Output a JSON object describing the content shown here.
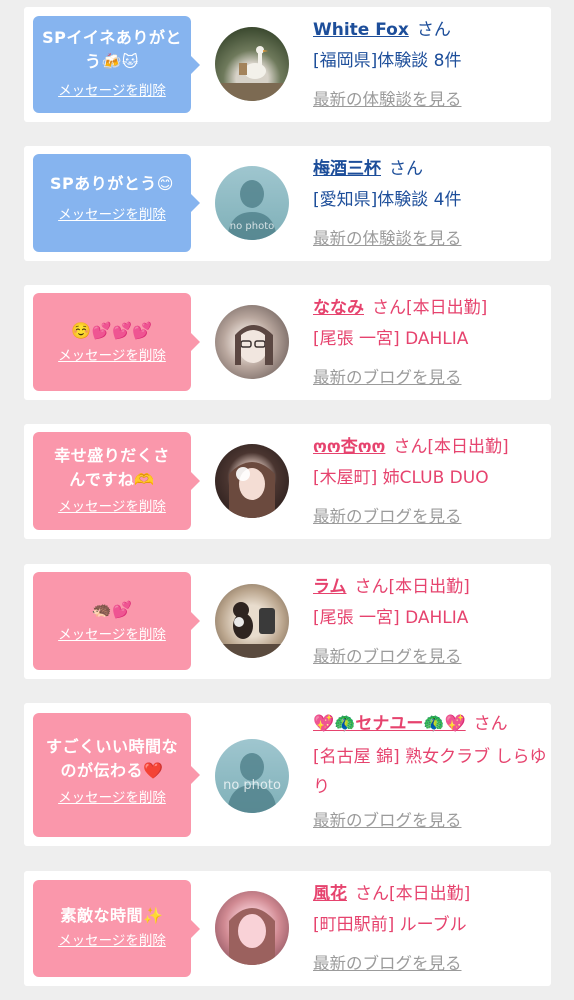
{
  "colors": {
    "blue_bubble": "#86b4ef",
    "pink_bubble": "#fa97ab",
    "blue_text": "#1d4e9a",
    "pink_text": "#e6436e",
    "link_gray": "#9b9b9b"
  },
  "cards": [
    {
      "message": "SPイイネありがとう🍻🐱",
      "delete_label": "メッセージを削除",
      "name": "White Fox",
      "honorific": "さん",
      "status": "",
      "area_line": "[福岡県]体験談 8件",
      "link": "最新の体験談を見る",
      "avatar": "photo-swan-garden"
    },
    {
      "message": "SPありがとう😊",
      "delete_label": "メッセージを削除",
      "name": "梅酒三杯",
      "honorific": "さん",
      "status": "",
      "area_line": "[愛知県]体験談 4件",
      "link": "最新の体験談を見る",
      "avatar": "no-photo-silhouette",
      "nophoto_text": "no photo"
    },
    {
      "message": "☺️💕💕💕",
      "delete_label": "メッセージを削除",
      "name": "ななみ",
      "honorific": "さん",
      "status": "[本日出勤]",
      "area_line": "[尾張 一宮] DAHLIA",
      "link": "最新のブログを見る",
      "avatar": "photo-woman-glasses"
    },
    {
      "message": "幸せ盛りだくさんですね🫶",
      "delete_label": "メッセージを削除",
      "name": "ოო杏ოო",
      "honorific": "さん",
      "status": "[本日出勤]",
      "area_line": "[木屋町] 姉CLUB DUO",
      "link": "最新のブログを見る",
      "avatar": "photo-woman-dark-hair"
    },
    {
      "message": "🦔💕",
      "delete_label": "メッセージを削除",
      "name": "ラム",
      "honorific": "さん",
      "status": "[本日出勤]",
      "area_line": "[尾張 一宮] DAHLIA",
      "link": "最新のブログを見る",
      "avatar": "photo-woman-mirror"
    },
    {
      "message": "すごくいい時間なのが伝わる❤️",
      "delete_label": "メッセージを削除",
      "name": "💖🦚セナユー🦚💖",
      "honorific": "さん",
      "status": "",
      "area_line": "[名古屋 錦] 熟女クラブ しらゆり",
      "link": "最新のブログを見る",
      "avatar": "no-photo-silhouette",
      "nophoto_text": "no photo"
    },
    {
      "message": "素敵な時間✨",
      "delete_label": "メッセージを削除",
      "name": "風花",
      "honorific": "さん",
      "status": "[本日出勤]",
      "area_line": "[町田駅前] ルーブル",
      "link": "最新のブログを見る",
      "avatar": "photo-woman-pink"
    }
  ]
}
